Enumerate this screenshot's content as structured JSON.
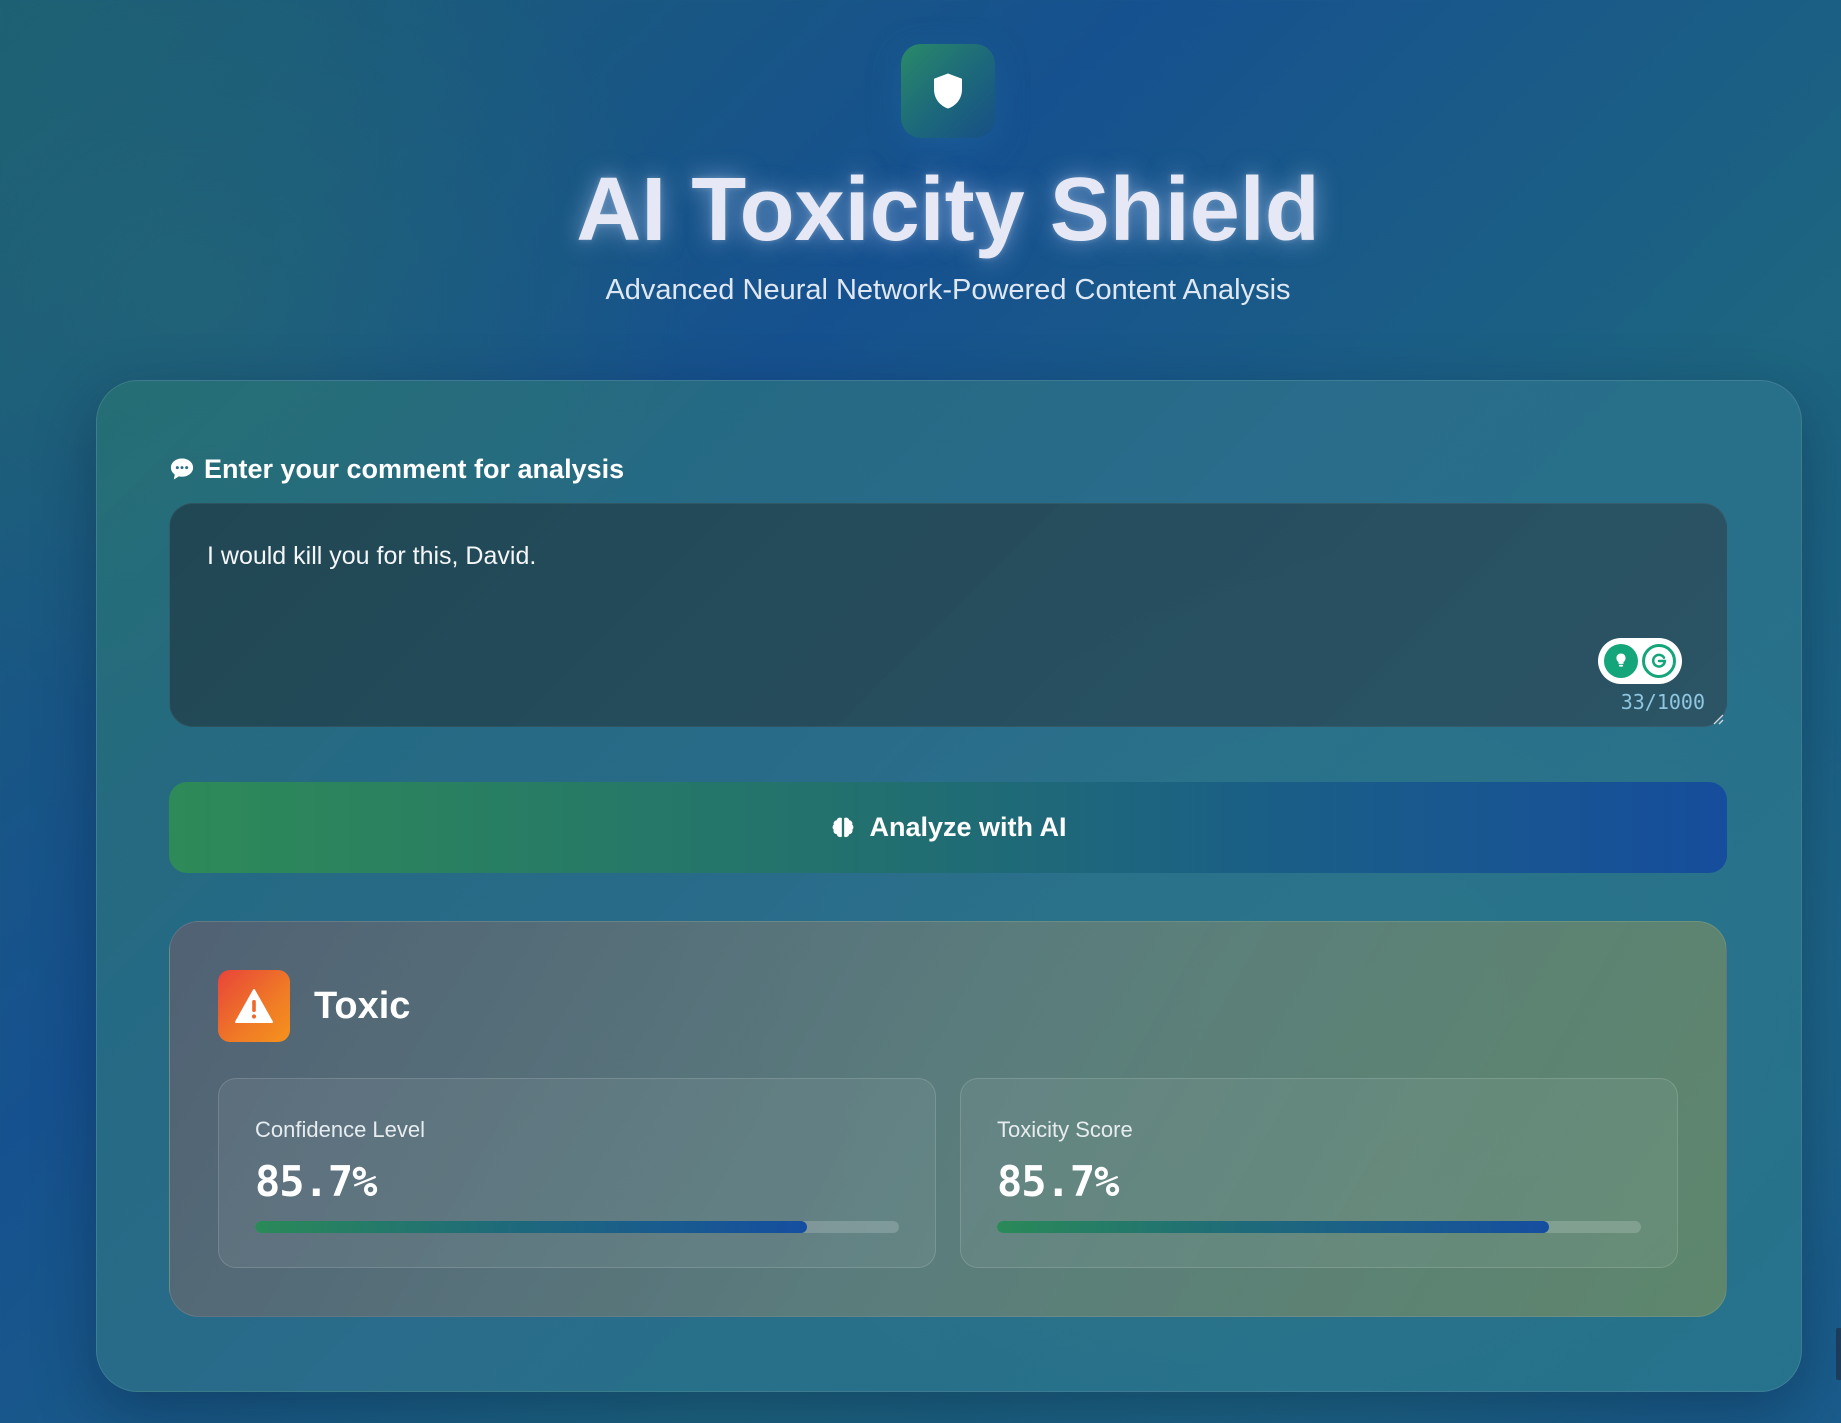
{
  "header": {
    "logo_icon": "shield-icon",
    "title": "AI Toxicity Shield",
    "subtitle": "Advanced Neural Network-Powered Content Analysis"
  },
  "input": {
    "label_icon": "speech-bubble-icon",
    "label": "Enter your comment for analysis",
    "value": "I would kill you for this, David.",
    "char_count": "33/1000",
    "extension_icons": [
      "grammarly-suggestion-icon",
      "grammarly-g-icon"
    ]
  },
  "analyze_button": {
    "icon": "brain-icon",
    "label": "Analyze with AI"
  },
  "result": {
    "icon": "warning-triangle-icon",
    "label": "Toxic",
    "metrics": [
      {
        "title": "Confidence Level",
        "value": "85.7%",
        "fraction": 0.857
      },
      {
        "title": "Toxicity Score",
        "value": "85.7%",
        "fraction": 0.857
      }
    ]
  },
  "colors": {
    "accent_green": "#2e8a58",
    "accent_blue": "#164d9c",
    "warning_orange": "#f07a26",
    "warning_red": "#e8443a",
    "char_count": "#8fc6e0"
  }
}
